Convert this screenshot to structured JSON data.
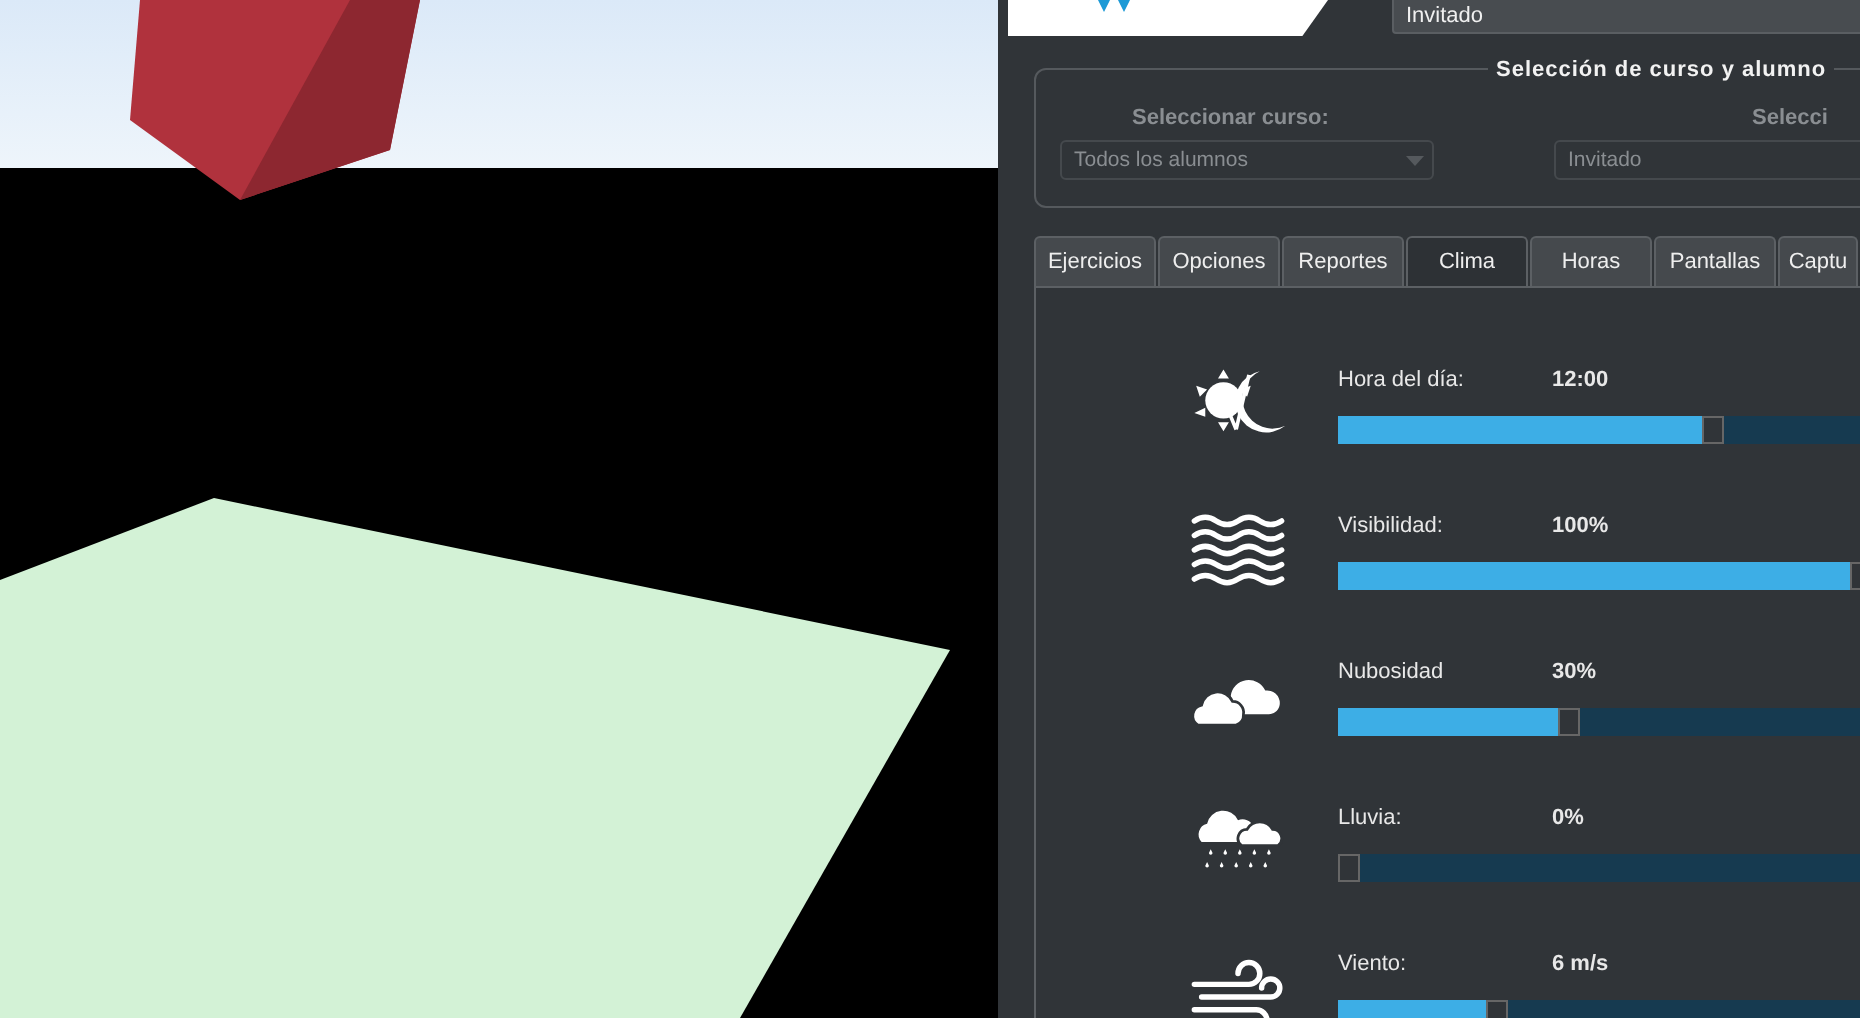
{
  "header": {
    "student_select": {
      "value": "Invitado"
    }
  },
  "course_selection": {
    "legend": "Selección de curso y alumno",
    "course": {
      "label": "Seleccionar curso:",
      "value": "Todos los alumnos",
      "disabled": true
    },
    "student": {
      "label": "Selecci",
      "value": "Invitado",
      "disabled": true
    }
  },
  "tabs": [
    {
      "label": "Ejercicios",
      "selected": false
    },
    {
      "label": "Opciones",
      "selected": false
    },
    {
      "label": "Reportes",
      "selected": false
    },
    {
      "label": "Clima",
      "selected": true
    },
    {
      "label": "Horas",
      "selected": false
    },
    {
      "label": "Pantallas",
      "selected": false
    },
    {
      "label": "Captu",
      "selected": false
    }
  ],
  "weather": [
    {
      "kind": "time",
      "label": "Hora del día:",
      "reading": "12:00",
      "level": 0.71
    },
    {
      "kind": "visibility",
      "label": "Visibilidad:",
      "reading": "100%",
      "level": 1
    },
    {
      "kind": "clouds",
      "label": "Nubosidad",
      "reading": "30%",
      "level": 0.43
    },
    {
      "kind": "rain",
      "label": "Lluvia:",
      "reading": "0%",
      "level": 0
    },
    {
      "kind": "wind",
      "label": "Viento:",
      "reading": "6 m/s",
      "level": 0.29
    }
  ]
}
